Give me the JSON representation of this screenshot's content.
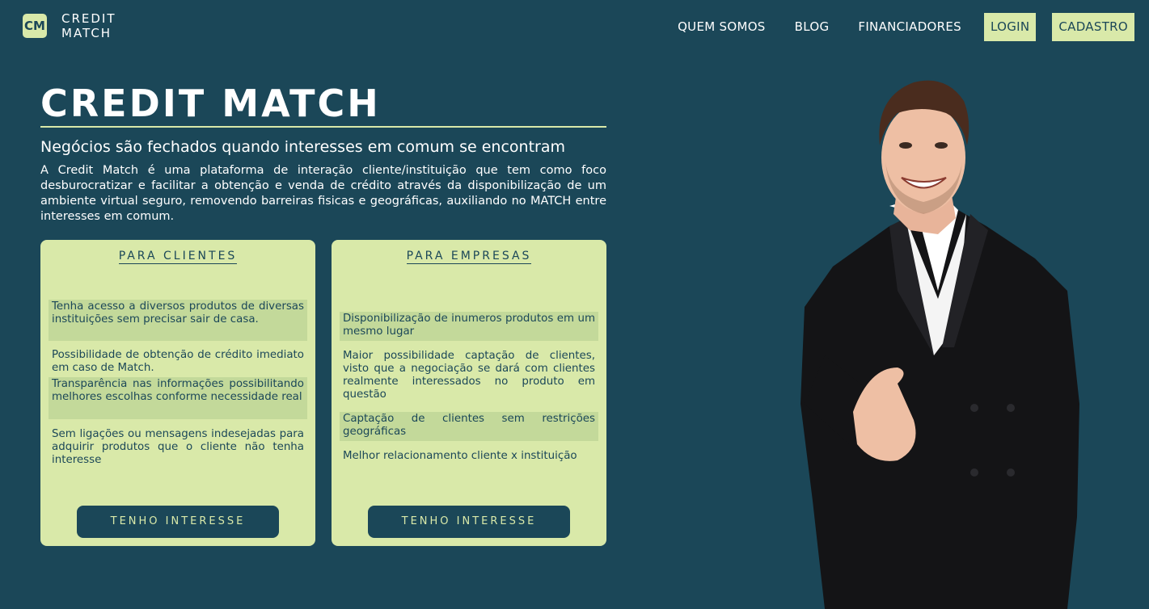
{
  "nav": {
    "logo_badge": "CM",
    "logo_line1": "CREDIT",
    "logo_line2": "MATCH",
    "links": [
      "QUEM SOMOS",
      "BLOG",
      "FINANCIADORES"
    ],
    "login": "LOGIN",
    "signup": "CADASTRO"
  },
  "hero": {
    "title": "CREDIT MATCH",
    "subtitle": "Negócios são fechados quando interesses em comum se encontram",
    "description": "A Credit Match é uma plataforma de interação cliente/instituição que tem como foco desburocratizar e facilitar a obtenção e venda de crédito através da disponibilização de um ambiente virtual seguro, removendo barreiras fisicas e geográficas, auxiliando no MATCH entre interesses em comum."
  },
  "cards": {
    "clients": {
      "title": "PARA CLIENTES",
      "items": [
        "Tenha acesso a diversos produtos de diversas instituições sem precisar sair de casa.",
        "Possibilidade de obtenção de crédito imediato em caso de Match.",
        "Transparência nas informações possibilitando melhores escolhas conforme necessidade real",
        "Sem ligações ou mensagens indesejadas para adquirir produtos que o cliente não tenha interesse"
      ],
      "button": "TENHO INTERESSE"
    },
    "companies": {
      "title": "PARA EMPRESAS",
      "items": [
        "Disponibilização de inumeros produtos em um mesmo lugar",
        "Maior possibilidade captação de clientes, visto que a negociação se dará com clientes realmente interessados no produto em questão",
        "Captação de clientes sem restrições geográficas",
        "Melhor relacionamento cliente x instituição"
      ],
      "button": "TENHO INTERESSE"
    }
  },
  "colors": {
    "background": "#1b4758",
    "accent": "#d9e9a9",
    "item_highlight": "#c3d99a"
  }
}
